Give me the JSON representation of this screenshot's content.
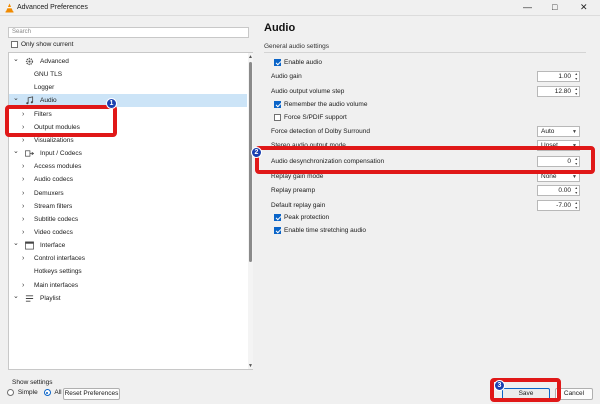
{
  "window": {
    "title": "Advanced Preferences",
    "minimize": "—",
    "maximize": "□",
    "close": "✕"
  },
  "search": {
    "placeholder": "Search"
  },
  "only_show_current": {
    "label": "Only show current",
    "checked": false
  },
  "tree": {
    "items": [
      {
        "label": "Advanced",
        "indent": 0,
        "chevron": "down",
        "icon": "gear-icon"
      },
      {
        "label": "GNU TLS",
        "indent": 1
      },
      {
        "label": "Logger",
        "indent": 1
      },
      {
        "label": "Audio",
        "indent": 0,
        "chevron": "down",
        "icon": "music-note-icon",
        "selected": true
      },
      {
        "label": "Filters",
        "indent": 1,
        "chevron": "right"
      },
      {
        "label": "Output modules",
        "indent": 1,
        "chevron": "right"
      },
      {
        "label": "Visualizations",
        "indent": 1,
        "chevron": "right"
      },
      {
        "label": "Input / Codecs",
        "indent": 0,
        "chevron": "down",
        "icon": "input-codecs-icon"
      },
      {
        "label": "Access modules",
        "indent": 1,
        "chevron": "right"
      },
      {
        "label": "Audio codecs",
        "indent": 1,
        "chevron": "right"
      },
      {
        "label": "Demuxers",
        "indent": 1,
        "chevron": "right"
      },
      {
        "label": "Stream filters",
        "indent": 1,
        "chevron": "right"
      },
      {
        "label": "Subtitle codecs",
        "indent": 1,
        "chevron": "right"
      },
      {
        "label": "Video codecs",
        "indent": 1,
        "chevron": "right"
      },
      {
        "label": "Interface",
        "indent": 0,
        "chevron": "down",
        "icon": "interface-icon"
      },
      {
        "label": "Control interfaces",
        "indent": 1,
        "chevron": "right"
      },
      {
        "label": "Hotkeys settings",
        "indent": 1
      },
      {
        "label": "Main interfaces",
        "indent": 1,
        "chevron": "right"
      },
      {
        "label": "Playlist",
        "indent": 0,
        "chevron": "down",
        "icon": "playlist-icon"
      }
    ]
  },
  "panel": {
    "title": "Audio",
    "section": "General audio settings",
    "enable_audio": {
      "label": "Enable audio",
      "checked": true
    },
    "audio_gain": {
      "label": "Audio gain",
      "value": "1.00"
    },
    "volume_step": {
      "label": "Audio output volume step",
      "value": "12.80"
    },
    "remember_volume": {
      "label": "Remember the audio volume",
      "checked": true
    },
    "force_spdif": {
      "label": "Force S/PDIF support",
      "checked": false
    },
    "dolby": {
      "label": "Force detection of Dolby Surround",
      "value": "Auto"
    },
    "stereo_mode": {
      "label": "Stereo audio output mode",
      "value": "Unset"
    },
    "desync": {
      "label": "Audio desynchronization compensation",
      "value": "0"
    },
    "replay_gain_mode": {
      "label": "Replay gain mode",
      "value": "None"
    },
    "replay_preamp": {
      "label": "Replay preamp",
      "value": "0.00"
    },
    "default_replay_gain": {
      "label": "Default replay gain",
      "value": "-7.00"
    },
    "peak_protection": {
      "label": "Peak protection",
      "checked": true
    },
    "time_stretch": {
      "label": "Enable time stretching audio",
      "checked": true
    }
  },
  "badges": [
    "1",
    "2",
    "3"
  ],
  "footer": {
    "show_settings_label": "Show settings",
    "simple_label": "Simple",
    "all_label": "All",
    "selected": "All",
    "reset_label": "Reset Preferences",
    "save_label": "Save",
    "cancel_label": "Cancel"
  },
  "colors": {
    "accent": "#0a64c8",
    "highlight_box": "#e01818",
    "badge": "#1a3fb0",
    "selection": "#cce4f7"
  }
}
